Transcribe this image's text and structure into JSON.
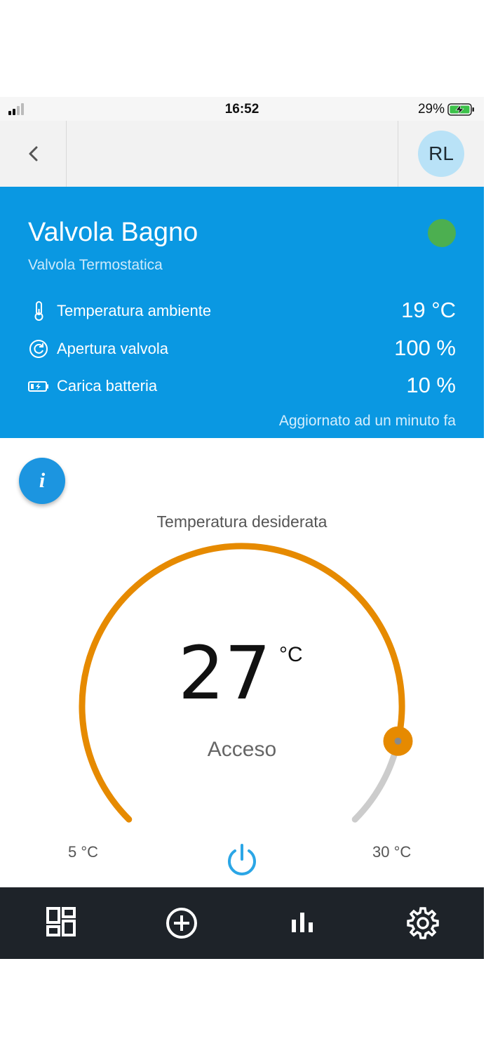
{
  "status_bar": {
    "time": "16:52",
    "battery_percent": "29%",
    "signal_bars": 2,
    "battery_charging": true
  },
  "nav": {
    "avatar_initials": "RL",
    "back_icon": "chevron-left-icon"
  },
  "device": {
    "name": "Valvola Bagno",
    "type": "Valvola Termostatica",
    "online_status_color": "#4caf50",
    "metrics": [
      {
        "icon": "thermometer-icon",
        "label": "Temperatura ambiente",
        "value": "19 °C"
      },
      {
        "icon": "valve-refresh-icon",
        "label": "Apertura valvola",
        "value": "100 %"
      },
      {
        "icon": "battery-charging-icon",
        "label": "Carica batteria",
        "value": "10 %"
      }
    ],
    "updated": "Aggiornato ad un minuto fa"
  },
  "thermostat": {
    "info_label": "i",
    "desired_label": "Temperatura desiderata",
    "setpoint": "27",
    "unit": "°C",
    "state": "Acceso",
    "min_label": "5 °C",
    "max_label": "30 °C",
    "min_value": 5,
    "max_value": 30,
    "setpoint_value": 27,
    "active_color": "#e68a00",
    "inactive_color": "#cccccc"
  },
  "tabbar": {
    "items": [
      {
        "icon": "dashboard-icon"
      },
      {
        "icon": "add-circle-icon"
      },
      {
        "icon": "bar-chart-icon"
      },
      {
        "icon": "gear-icon"
      }
    ]
  },
  "colors": {
    "panel_bg": "#0a98e2",
    "accent_blue": "#2ba6e6",
    "tabbar_bg": "#1e2329"
  }
}
